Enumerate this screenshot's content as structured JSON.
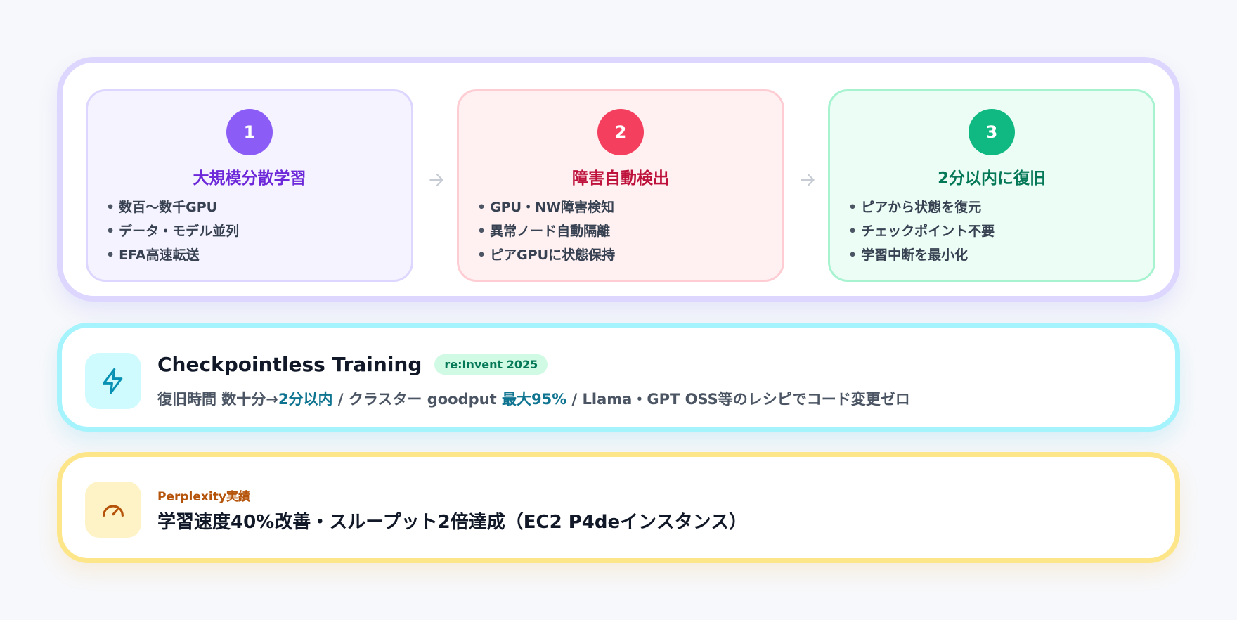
{
  "flow": {
    "steps": [
      {
        "number": "1",
        "title": "大規模分散学習",
        "bullets": [
          "数百〜数千GPU",
          "データ・モデル並列",
          "EFA高速転送"
        ],
        "accent": "#8b5cf6"
      },
      {
        "number": "2",
        "title": "障害自動検出",
        "bullets": [
          "GPU・NW障害検知",
          "異常ノード自動隔離",
          "ピアGPUに状態保持"
        ],
        "accent": "#f43f5e"
      },
      {
        "number": "3",
        "title": "2分以内に復旧",
        "bullets": [
          "ピアから状態を復元",
          "チェックポイント不要",
          "学習中断を最小化"
        ],
        "accent": "#10b981"
      }
    ],
    "arrow_icon": "arrow-right-icon"
  },
  "checkpointless": {
    "icon": "lightning-icon",
    "title": "Checkpointless Training",
    "tag": "re:Invent 2025",
    "desc": {
      "p1": "復旧時間 数十分→",
      "h1": "2分以内",
      "p2": " / クラスター goodput ",
      "h2": "最大95%",
      "p3": " / Llama・GPT OSS等のレシピでコード変更ゼロ"
    },
    "accent": "#06b6d4"
  },
  "perplexity": {
    "icon": "gauge-icon",
    "kicker": "Perplexity実績",
    "title": "学習速度40%改善・スループット2倍達成（EC2 P4deインスタンス）",
    "accent": "#f59e0b"
  }
}
